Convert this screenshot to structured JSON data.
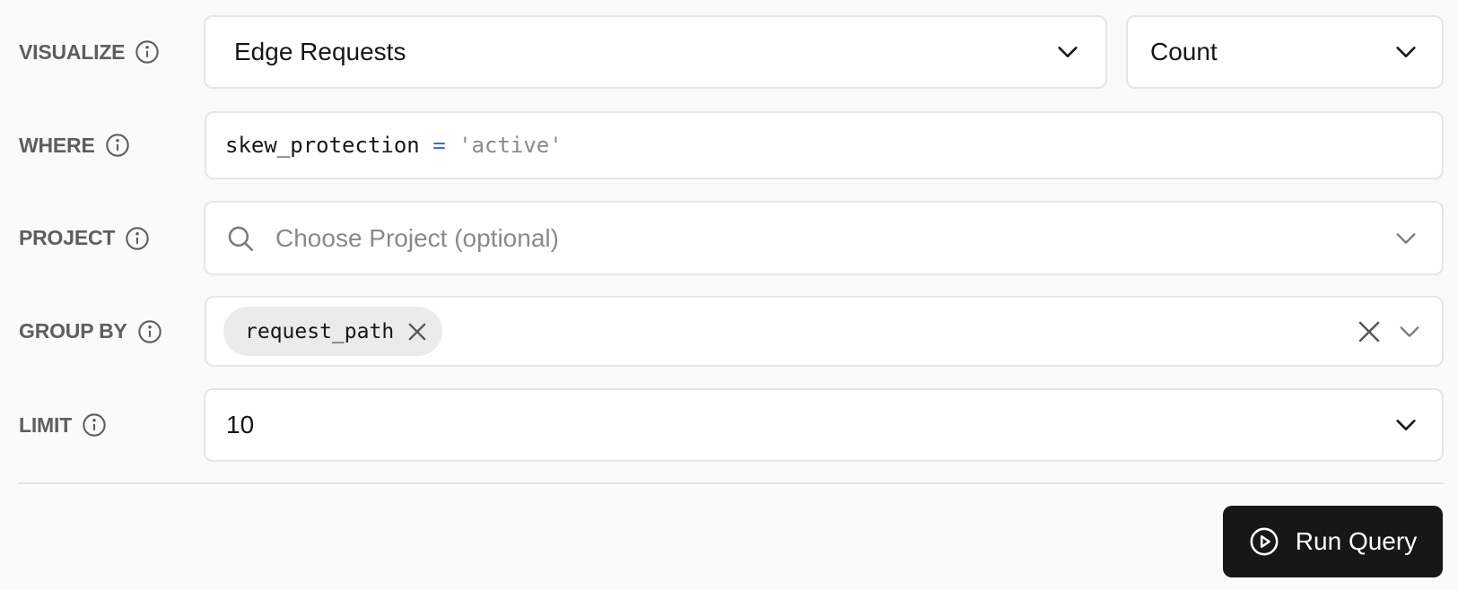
{
  "visualize": {
    "label": "VISUALIZE",
    "dataset": "Edge Requests",
    "aggregation": "Count"
  },
  "where": {
    "label": "WHERE",
    "field": "skew_protection",
    "operator": "=",
    "value": "'active'"
  },
  "project": {
    "label": "PROJECT",
    "placeholder": "Choose Project (optional)"
  },
  "group_by": {
    "label": "GROUP BY",
    "chips": [
      "request_path"
    ]
  },
  "limit": {
    "label": "LIMIT",
    "value": "10"
  },
  "actions": {
    "run_label": "Run Query"
  },
  "icons": {
    "info": "info-icon",
    "chevron": "chevron-down-icon",
    "search": "search-icon",
    "clear": "close-icon",
    "play": "play-circle-icon"
  },
  "colors": {
    "background": "#fafafa",
    "label": "#5e5e5e",
    "operator": "#2f6fe0",
    "string_value": "#8a8a8a",
    "primary_button": "#171717"
  }
}
